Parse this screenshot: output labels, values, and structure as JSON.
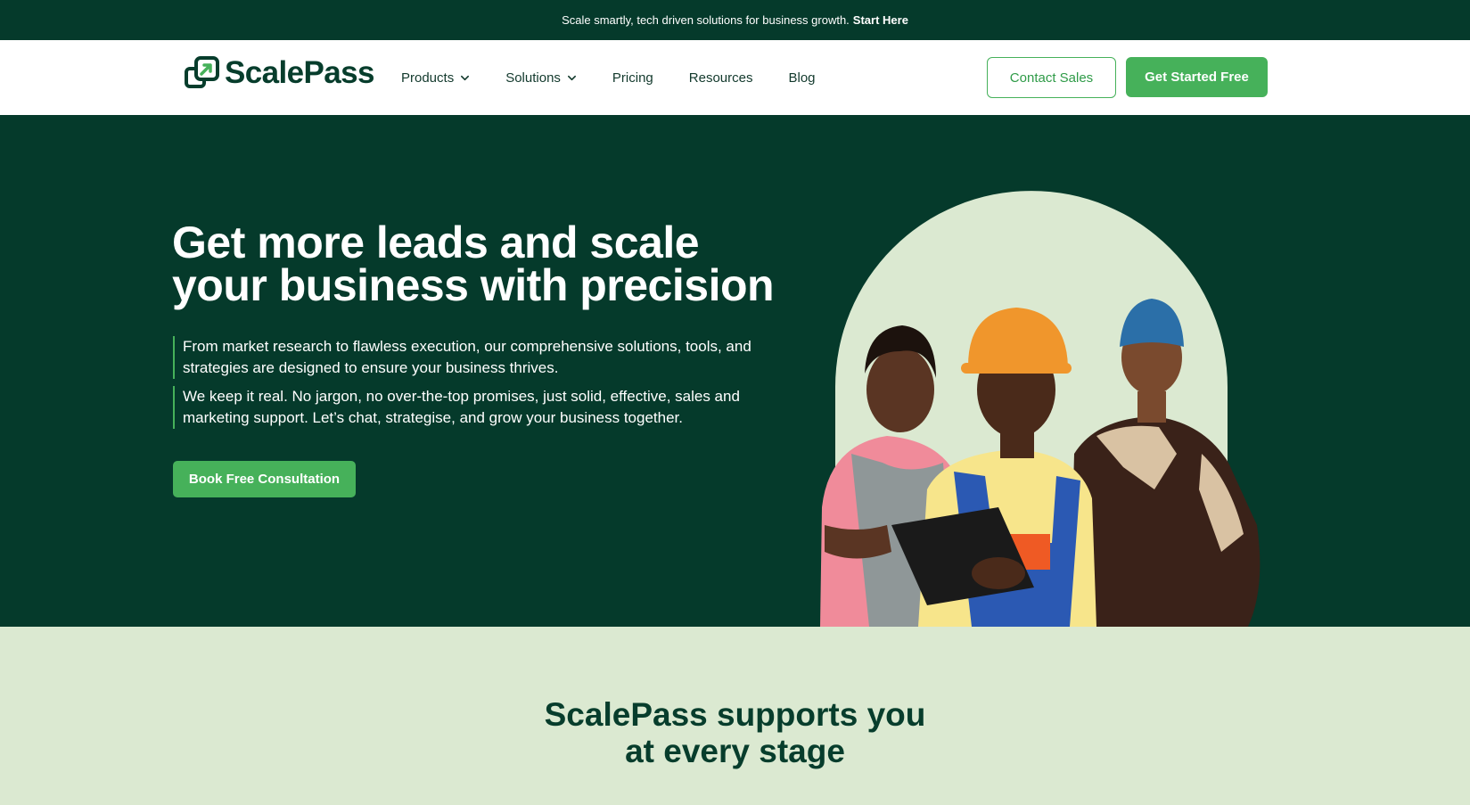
{
  "announcement": {
    "text": "Scale smartly, tech driven solutions for business growth.",
    "cta": "Start Here"
  },
  "header": {
    "logo_text": "ScalePass",
    "nav": [
      {
        "label": "Products",
        "dropdown": true
      },
      {
        "label": "Solutions",
        "dropdown": true
      },
      {
        "label": "Pricing",
        "dropdown": false
      },
      {
        "label": "Resources",
        "dropdown": false
      },
      {
        "label": "Blog",
        "dropdown": false
      }
    ],
    "contact_sales": "Contact Sales",
    "get_started": "Get Started Free"
  },
  "hero": {
    "title_line1": "Get more leads and scale",
    "title_line2": "your business with precision",
    "paragraph1": "From market research to flawless execution, our comprehensive solutions, tools, and strategies are designed to ensure your business thrives.",
    "paragraph2": "We keep it real. No jargon, no over-the-top promises, just solid, effective, sales and marketing support. Let’s chat, strategise, and grow your business together.",
    "cta": "Book Free Consultation"
  },
  "stage_section": {
    "title_line1": "ScalePass supports you",
    "title_line2": "at every stage"
  },
  "colors": {
    "dark_green": "#053a2b",
    "brand_green": "#46b15a",
    "light_green": "#dbe9d1",
    "white": "#ffffff"
  },
  "icons": [
    "scalepass-logo-icon",
    "chevron-down-icon"
  ]
}
